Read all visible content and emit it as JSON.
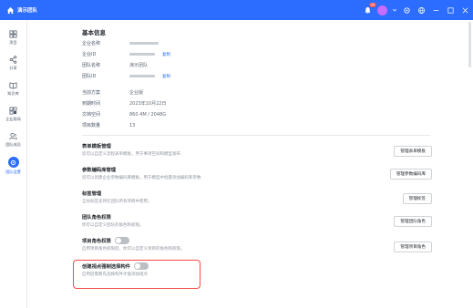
{
  "titlebar": {
    "team_name": "演示团队",
    "notification_count": "99",
    "bg_color": "#2c6cff"
  },
  "sidebar": {
    "items": [
      {
        "label": "项目",
        "icon": "grid-icon"
      },
      {
        "label": "分享",
        "icon": "share-icon"
      },
      {
        "label": "知识库",
        "icon": "book-icon"
      },
      {
        "label": "企业版场",
        "icon": "apps-icon"
      },
      {
        "label": "团队成员",
        "icon": "members-icon"
      },
      {
        "label": "团队设置",
        "icon": "settings-icon",
        "active": true
      }
    ]
  },
  "basic_info": {
    "title": "基本信息",
    "company_name_label": "企业名称",
    "company_id_label": "企业ID",
    "team_name_label": "团队名称",
    "team_name_value": "演示团队",
    "team_id_label": "团队ID",
    "copy_label": "复制",
    "plan_label": "当前方案",
    "plan_value": "企业版",
    "expire_label": "到期时间",
    "expire_value": "2023年10月22日",
    "storage_label": "文档空间",
    "storage_value": "860.4M / 2048G",
    "project_count_label": "项目数量",
    "project_count_value": "13"
  },
  "settings": [
    {
      "title": "表单模板管理",
      "desc": "您可以自定义流程表单模板，用于事项空间和模型发布",
      "button": "管理表单模板"
    },
    {
      "title": "参数编码库管理",
      "desc": "您可以创建企业参数编码库模板，用于模型中批量添加编码和参数",
      "button": "管理参数编码库"
    },
    {
      "title": "标签管理",
      "desc": "全局标签支持在团队所有项目中使用。",
      "button": "管理标签"
    },
    {
      "title": "团队角色权限",
      "desc": "你可以自定义团队的角色和权限。",
      "button": "管理团队角色"
    },
    {
      "title": "项目角色权限",
      "desc": "启用项目角色权限后，你可以自定义项目的角色和权限。",
      "button": "管理项目角色",
      "toggle": false
    },
    {
      "title": "创建视点强制选择构件",
      "desc": "启用后需要先选择构件才能添加视点",
      "toggle": false
    }
  ]
}
